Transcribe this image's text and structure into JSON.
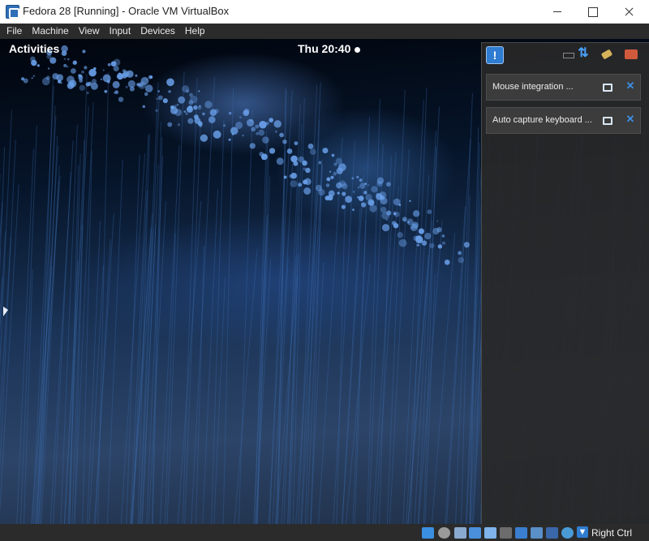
{
  "window": {
    "title": "Fedora 28 [Running] - Oracle VM VirtualBox",
    "app_icon": "virtualbox-icon"
  },
  "menubar": {
    "items": [
      "File",
      "Machine",
      "View",
      "Input",
      "Devices",
      "Help"
    ]
  },
  "guest": {
    "activities_label": "Activities",
    "clock_label": "Thu 20:40"
  },
  "notification_center": {
    "toggle_icon": "notification-center-icon",
    "status_icons": [
      "network-icon",
      "upload-download-icon",
      "mouse-integration-icon",
      "keyboard-capture-icon"
    ],
    "items": [
      {
        "text": "Mouse integration ...",
        "pin_icon": "pin-icon",
        "close_icon": "close-icon"
      },
      {
        "text": "Auto capture keyboard ...",
        "pin_icon": "pin-icon",
        "close_icon": "close-icon"
      }
    ]
  },
  "statusbar": {
    "icons": [
      "hard-disk-icon",
      "optical-drive-icon",
      "audio-icon",
      "network-icon",
      "usb-icon",
      "shared-folders-icon",
      "display-icon",
      "video-capture-icon",
      "virtualization-icon",
      "mouse-integration-icon",
      "host-key-icon"
    ],
    "host_key_label": "Right Ctrl"
  },
  "colors": {
    "titlebar_bg": "#ffffff",
    "menubar_bg": "#2b2b2b",
    "panel_bg": "#282828",
    "accent_blue": "#2f7cd1"
  }
}
